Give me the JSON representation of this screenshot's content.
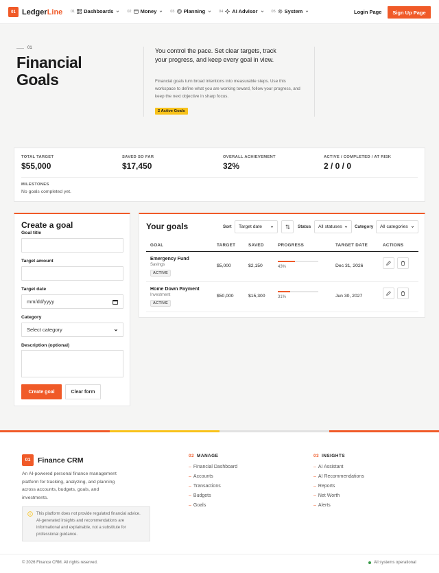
{
  "nav": {
    "logo_mark": "01",
    "logo_main": "Ledger",
    "logo_accent": "Line",
    "menu": [
      {
        "num": "01",
        "label": "Dashboards",
        "icon": "grid-icon"
      },
      {
        "num": "02",
        "label": "Money",
        "icon": "wallet-icon"
      },
      {
        "num": "03",
        "label": "Planning",
        "icon": "target-icon"
      },
      {
        "num": "04",
        "label": "AI Advisor",
        "icon": "sparkle-icon"
      },
      {
        "num": "05",
        "label": "System",
        "icon": "gear-icon"
      }
    ],
    "login": "Login Page",
    "signup": "Sign Up Page"
  },
  "hero": {
    "eyebrow": "01",
    "title": "Financial Goals",
    "lead": "You control the pace. Set clear targets, track your progress, and keep every goal in view.",
    "body": "Financial goals turn broad intentions into measurable steps. Use this workspace to define what you are working toward, follow your progress, and keep the next objective in sharp focus.",
    "badge": "2 Active Goals"
  },
  "stats": {
    "total_target_label": "TOTAL TARGET",
    "total_target": "$55,000",
    "saved_label": "SAVED SO FAR",
    "saved": "$17,450",
    "achievement_label": "OVERALL ACHIEVEMENT",
    "achievement": "32%",
    "counts_label": "ACTIVE / COMPLETED / AT RISK",
    "counts": "2 / 0 / 0",
    "milestones_label": "MILESTONES",
    "milestones_text": "No goals completed yet."
  },
  "create": {
    "title": "Create a goal",
    "goal_title_label": "Goal title",
    "target_amount_label": "Target amount",
    "target_date_label": "Target date",
    "target_date_placeholder": "mm/dd/yyyy",
    "category_label": "Category",
    "category_value": "Select category",
    "description_label": "Description (optional)",
    "create_button": "Create goal",
    "clear_button": "Clear form"
  },
  "goals": {
    "title": "Your goals",
    "sort_label": "Sort",
    "sort_value": "Target date",
    "status_label": "Status",
    "status_value": "All statuses",
    "category_label": "Category",
    "category_value": "All categories",
    "columns": [
      "GOAL",
      "TARGET",
      "SAVED",
      "PROGRESS",
      "TARGET DATE",
      "ACTIONS"
    ],
    "rows": [
      {
        "name": "Emergency Fund",
        "category": "Savings",
        "status": "ACTIVE",
        "target": "$5,000",
        "saved": "$2,150",
        "progress": 43,
        "progress_text": "43%",
        "date": "Dec 31, 2026"
      },
      {
        "name": "Home Down Payment",
        "category": "Investment",
        "status": "ACTIVE",
        "target": "$50,000",
        "saved": "$15,300",
        "progress": 31,
        "progress_text": "31%",
        "date": "Jun 30, 2027"
      }
    ]
  },
  "footer": {
    "logo_mark": "01",
    "brand": "Finance CRM",
    "desc": "An AI-powered personal finance management platform for tracking, analyzing, and planning across accounts, budgets, goals, and investments.",
    "note": "This platform does not provide regulated financial advice. AI-generated insights and recommendations are informational and explainable, not a substitute for professional guidance.",
    "manage_num": "02",
    "manage_title": "MANAGE",
    "manage_links": [
      "Financial Dashboard",
      "Accounts",
      "Transactions",
      "Budgets",
      "Goals"
    ],
    "insights_num": "03",
    "insights_title": "INSIGHTS",
    "insights_links": [
      "AI Assistant",
      "AI Recommendations",
      "Reports",
      "Net Worth",
      "Alerts"
    ],
    "copyright": "© 2026 Finance CRM. All rights reserved.",
    "status": "All systems operational",
    "stripe_colors": [
      "#f05a28",
      "#f8c21a",
      "#e2e2e2",
      "#f05a28"
    ]
  },
  "colors": {
    "accent": "#f05a28",
    "badge": "#f8c21a",
    "status_ok": "#3a9b4a"
  }
}
